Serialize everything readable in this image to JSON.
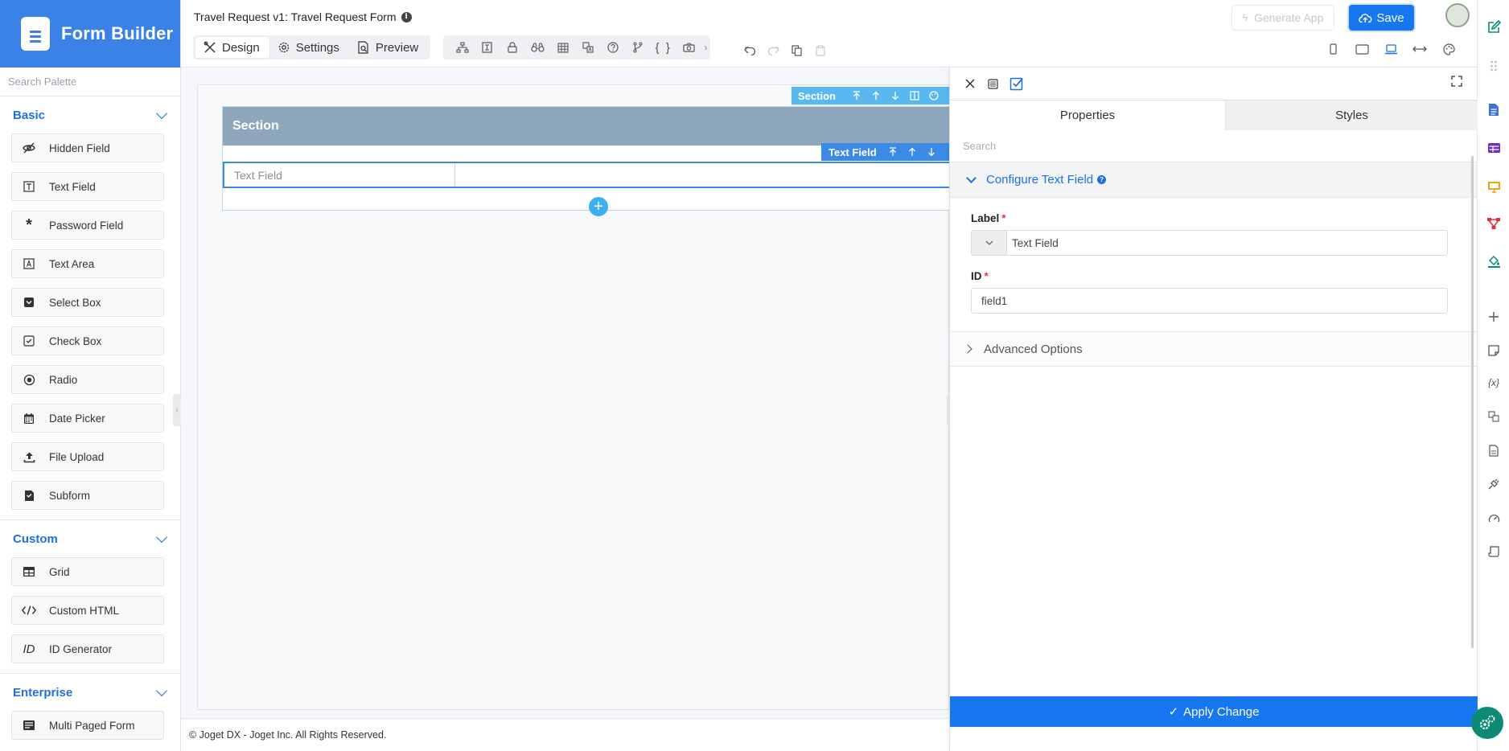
{
  "app": {
    "brand": "Form Builder"
  },
  "header": {
    "form_title": "Travel Request v1: Travel Request Form",
    "tabs": [
      "Design",
      "Settings",
      "Preview"
    ],
    "generate_app": "Generate App",
    "save": "Save"
  },
  "palette": {
    "search_placeholder": "Search Palette",
    "categories": [
      {
        "name": "Basic",
        "items": [
          "Hidden Field",
          "Text Field",
          "Password Field",
          "Text Area",
          "Select Box",
          "Check Box",
          "Radio",
          "Date Picker",
          "File Upload",
          "Subform"
        ]
      },
      {
        "name": "Custom",
        "items": [
          "Grid",
          "Custom HTML",
          "ID Generator"
        ]
      },
      {
        "name": "Enterprise",
        "items": [
          "Multi Paged Form"
        ]
      }
    ]
  },
  "canvas": {
    "section_title": "Section",
    "section_toolbar": "Section",
    "field_toolbar": "Text Field",
    "field_label": "Text Field",
    "footer": "© Joget DX - Joget Inc. All Rights Reserved."
  },
  "panel": {
    "tabs": [
      "Properties",
      "Styles"
    ],
    "search_placeholder": "Search",
    "group": "Configure Text Field",
    "label_field": {
      "label": "Label",
      "value": "Text Field"
    },
    "id_field": {
      "label": "ID",
      "value": "field1"
    },
    "advanced": "Advanced Options",
    "apply": "Apply Change"
  },
  "colors": {
    "brand": "#3b82e6",
    "primary": "#1677f0",
    "section": "#8fa7bd"
  }
}
